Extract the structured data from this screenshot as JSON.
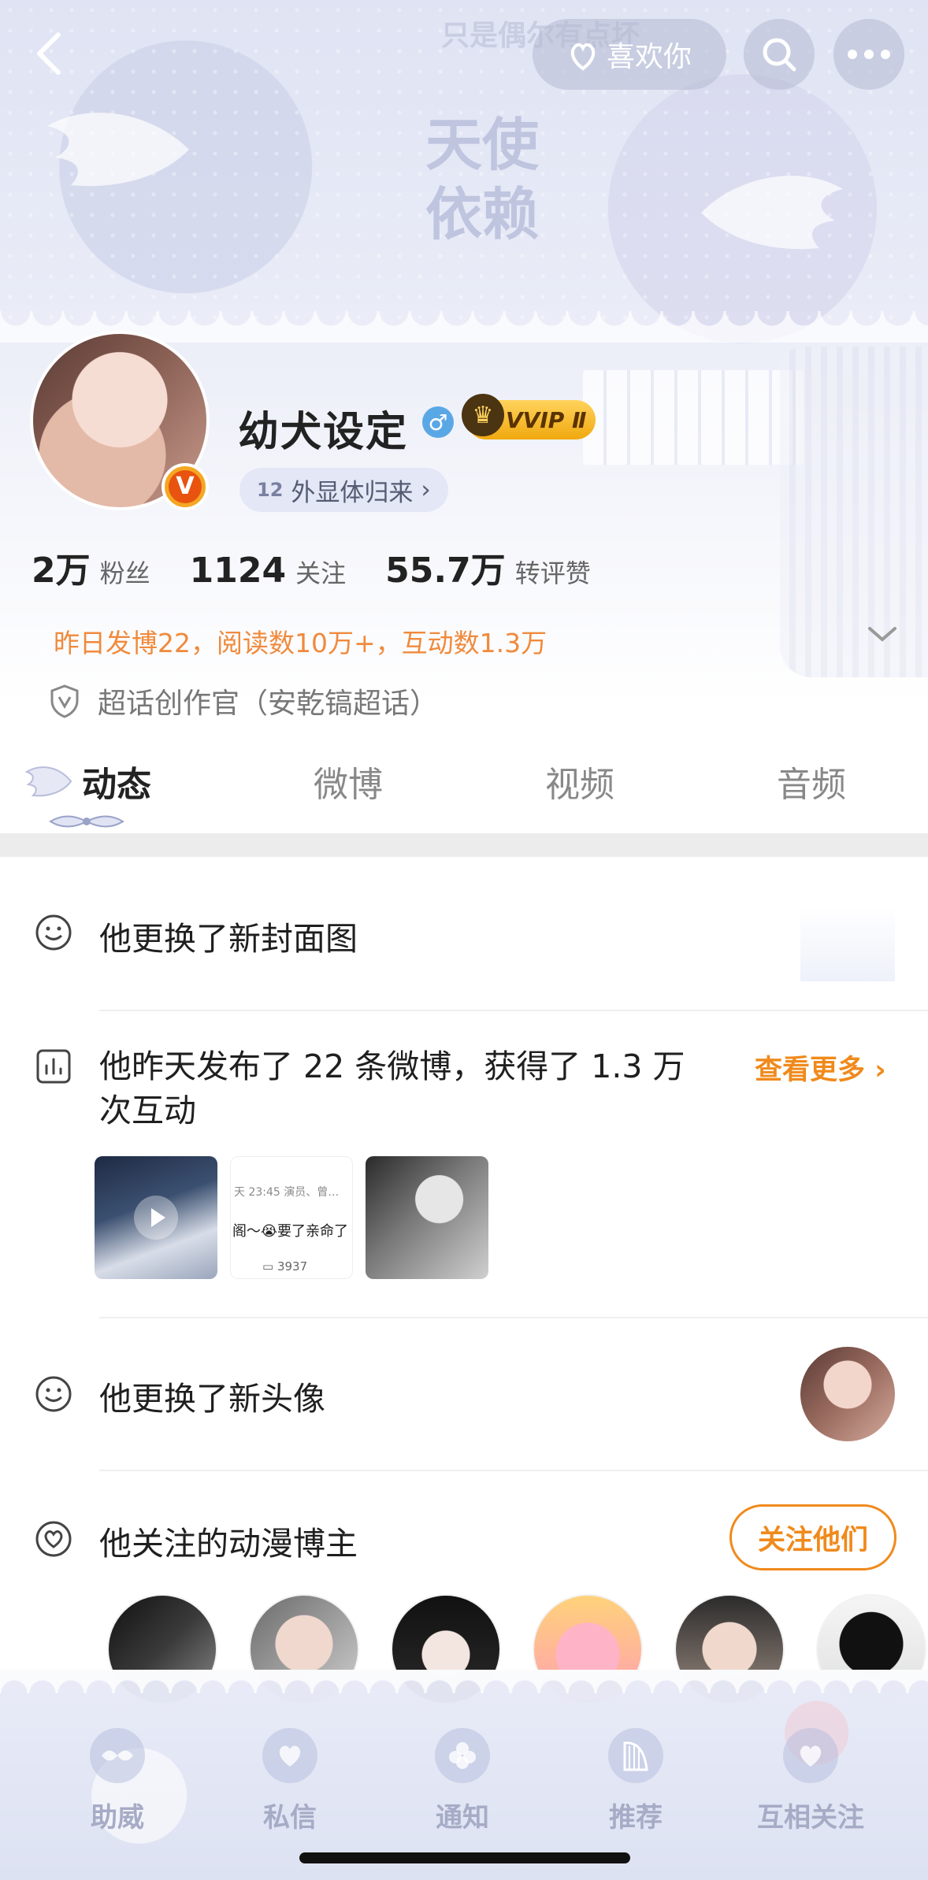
{
  "header": {
    "cover_heading": "天使\n依赖",
    "cover_top_text": "只是偶尔有点坏",
    "like_pill_label": "喜欢你"
  },
  "profile": {
    "username": "幼犬设定",
    "vip_label": "VVIP Ⅱ",
    "tag_label": "外显体归来",
    "tag_code": "12",
    "stats": [
      {
        "value": "2万",
        "label": "粉丝"
      },
      {
        "value": "1124",
        "label": "关注"
      },
      {
        "value": "55.7万",
        "label": "转评赞"
      }
    ],
    "summary": "昨日发博22，阅读数10万+，互动数1.3万",
    "super_topic": "超话创作官（安乾镐超话）"
  },
  "tabs": [
    "动态",
    "微博",
    "视频",
    "音频"
  ],
  "feed": {
    "cover_changed": "他更换了新封面图",
    "posted_summary": "他昨天发布了 22 条微博，获得了 1.3 万\n次互动",
    "see_more": "查看更多",
    "thumb2_meta": "天 23:45  演员、曾…",
    "thumb2_text": "阁～😭要了亲命了",
    "thumb2_count": "3937",
    "avatar_changed": "他更换了新头像",
    "anime_follow": "他关注的动漫博主",
    "follow_them": "关注他们"
  },
  "bottom_nav": [
    "助威",
    "私信",
    "通知",
    "推荐",
    "互相关注"
  ],
  "colors": {
    "accent": "#f08a1c",
    "summary": "#f08a3c",
    "vbadge": "#e8530f"
  }
}
